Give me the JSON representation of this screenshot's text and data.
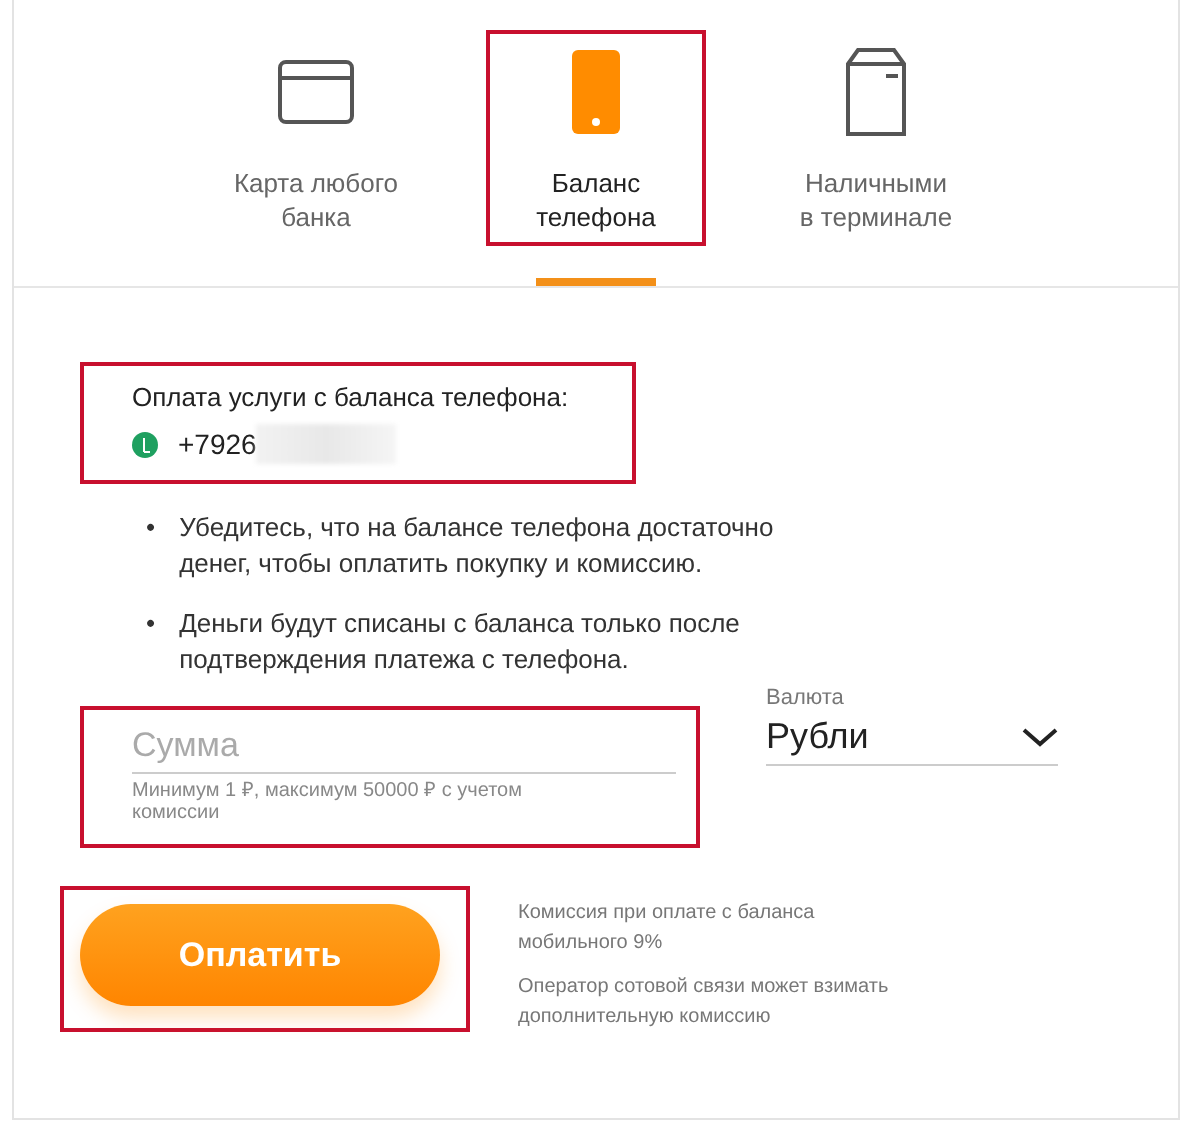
{
  "tabs": [
    {
      "kind": "card",
      "label": "Карта любого\nбанка",
      "selected": false,
      "highlighted": false
    },
    {
      "kind": "phone",
      "label": "Баланс\nтелефона",
      "selected": true,
      "highlighted": true
    },
    {
      "kind": "terminal",
      "label": "Наличными\nв терминале",
      "selected": false,
      "highlighted": false
    }
  ],
  "phone_section": {
    "title": "Оплата услуги с баланса телефона:",
    "number": "+7926",
    "number_blurred": true,
    "highlighted": true
  },
  "notes": [
    {
      "bullet": "•",
      "text": "Убедитесь, что на балансе телефона достаточно денег, чтобы оплатить покупку и комиссию."
    },
    {
      "bullet": "•",
      "text": "Деньги будут списаны с баланса только после подтверждения платежа с телефона."
    }
  ],
  "amount": {
    "placeholder": "Сумма",
    "hint": "Минимум 1 ₽, максимум 50000 ₽ с учетом комиссии",
    "highlighted": true
  },
  "currency": {
    "label": "Валюта",
    "value": "Рубли"
  },
  "pay_button": {
    "label": "Оплатить",
    "highlighted": true
  },
  "fee_notes": [
    "Комиссия при оплате с баланса мобильного 9%",
    "Оператор сотовой связи может взимать дополнительную комиссию"
  ]
}
